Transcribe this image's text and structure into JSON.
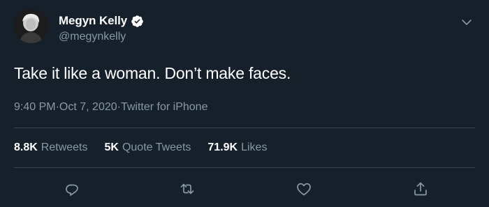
{
  "author": {
    "display_name": "Megyn Kelly",
    "handle": "@megynkelly",
    "verified": true,
    "avatar_icon": "profile-photo"
  },
  "tweet": {
    "text": "Take it like a woman. Don’t make faces.",
    "time": "9:40 PM",
    "separator1": " · ",
    "date": "Oct 7, 2020",
    "separator2": " · ",
    "source": "Twitter for iPhone"
  },
  "stats": {
    "retweets_count": "8.8K",
    "retweets_label": "Retweets",
    "quotes_count": "5K",
    "quotes_label": "Quote Tweets",
    "likes_count": "71.9K",
    "likes_label": "Likes"
  },
  "actions": {
    "reply_icon": "reply-icon",
    "retweet_icon": "retweet-icon",
    "like_icon": "heart-icon",
    "share_icon": "share-icon"
  },
  "colors": {
    "background": "#15202b",
    "primary_text": "#ffffff",
    "secondary_text": "#8899a6",
    "divider": "#38444d",
    "verified_badge": "#ffffff"
  }
}
